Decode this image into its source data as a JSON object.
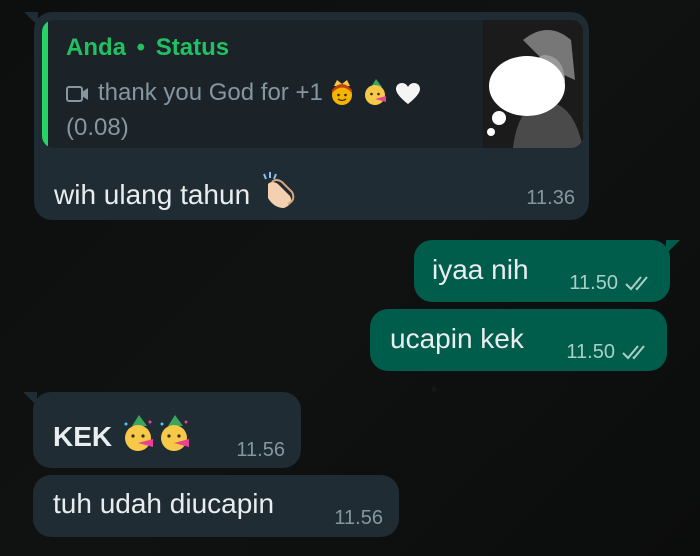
{
  "colors": {
    "incoming_bubble": "#1f2c33",
    "outgoing_bubble": "#005c4b",
    "accent_green": "#21c063",
    "timestamp": "#8696a0",
    "read_tick": "#a9d0c6"
  },
  "messages": [
    {
      "direction": "incoming",
      "quote": {
        "author": "Anda",
        "separator": "•",
        "label": "Status",
        "icon": "video-icon",
        "text_line1": "thank you God for +1",
        "emojis": [
          "princess-emoji",
          "party-face-emoji",
          "white-heart-emoji"
        ],
        "text_line2": "(0.08)",
        "thumbnail": "status-thumbnail-image"
      },
      "text": "wih ulang tahun",
      "emoji": "clapping-hands-emoji",
      "time": "11.36"
    },
    {
      "direction": "outgoing",
      "text": "iyaa nih",
      "time": "11.50",
      "status_icon": "double-check-icon"
    },
    {
      "direction": "outgoing",
      "text": "ucapin kek",
      "time": "11.50",
      "status_icon": "double-check-icon"
    },
    {
      "direction": "incoming",
      "text": "KEK",
      "emojis": [
        "party-face-emoji",
        "party-face-emoji"
      ],
      "time": "11.56"
    },
    {
      "direction": "incoming",
      "text": "tuh udah diucapin",
      "time": "11.56"
    }
  ]
}
